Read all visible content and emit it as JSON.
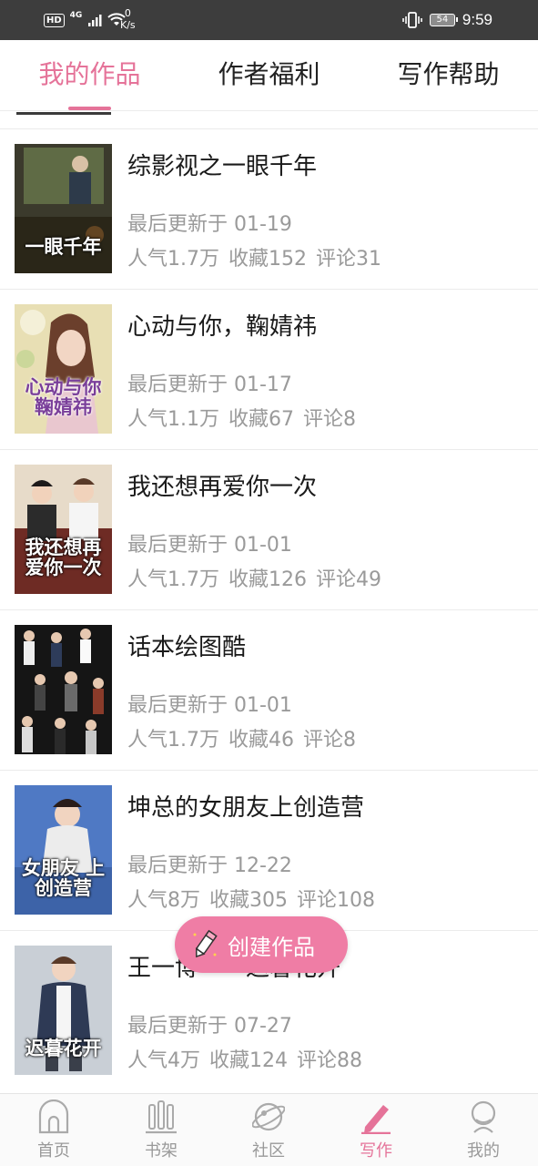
{
  "status_bar": {
    "hd": "HD",
    "network": "4G",
    "speed_value": "0",
    "speed_unit": "K/s",
    "battery": "54",
    "time": "9:59"
  },
  "tabs": [
    {
      "label": "我的作品",
      "active": true
    },
    {
      "label": "作者福利",
      "active": false
    },
    {
      "label": "写作帮助",
      "active": false
    }
  ],
  "works": [
    {
      "title": "综影视之一眼千年",
      "updated": "最后更新于 01-19",
      "popularity": "人气1.7万",
      "favorites": "收藏152",
      "comments": "评论31",
      "cover_text": "一眼千年",
      "cover_color": "#3b3a2c"
    },
    {
      "title": "心动与你，鞠婧祎",
      "updated": "最后更新于 01-17",
      "popularity": "人气1.1万",
      "favorites": "收藏67",
      "comments": "评论8",
      "cover_text": "心动与你 鞠婧祎",
      "cover_color": "#e8dfb4"
    },
    {
      "title": "我还想再爱你一次",
      "updated": "最后更新于 01-01",
      "popularity": "人气1.7万",
      "favorites": "收藏126",
      "comments": "评论49",
      "cover_text": "我还想再 爱你一次",
      "cover_color": "#6e2b24"
    },
    {
      "title": "话本绘图酷",
      "updated": "最后更新于 01-01",
      "popularity": "人气1.7万",
      "favorites": "收藏46",
      "comments": "评论8",
      "cover_text": "",
      "cover_color": "#151515"
    },
    {
      "title": "坤总的女朋友上创造营",
      "updated": "最后更新于 12-22",
      "popularity": "人气8万",
      "favorites": "收藏305",
      "comments": "评论108",
      "cover_text": "女朋友 上创造营",
      "cover_color": "#4f79c4"
    },
    {
      "title": "王一博——迟暮花开",
      "updated": "最后更新于 07-27",
      "popularity": "人气4万",
      "favorites": "收藏124",
      "comments": "评论88",
      "cover_text": "迟暮花开",
      "cover_color": "#c9cfd6"
    }
  ],
  "fab": {
    "label": "创建作品",
    "icon": "pencil-icon"
  },
  "bottom_nav": [
    {
      "label": "首页",
      "icon": "home-icon",
      "active": false
    },
    {
      "label": "书架",
      "icon": "bookshelf-icon",
      "active": false
    },
    {
      "label": "社区",
      "icon": "community-icon",
      "active": false
    },
    {
      "label": "写作",
      "icon": "write-icon",
      "active": true
    },
    {
      "label": "我的",
      "icon": "profile-icon",
      "active": false
    }
  ],
  "colors": {
    "accent": "#e57399",
    "fab": "#ef7da5",
    "status_bar": "#3d3d3d"
  }
}
